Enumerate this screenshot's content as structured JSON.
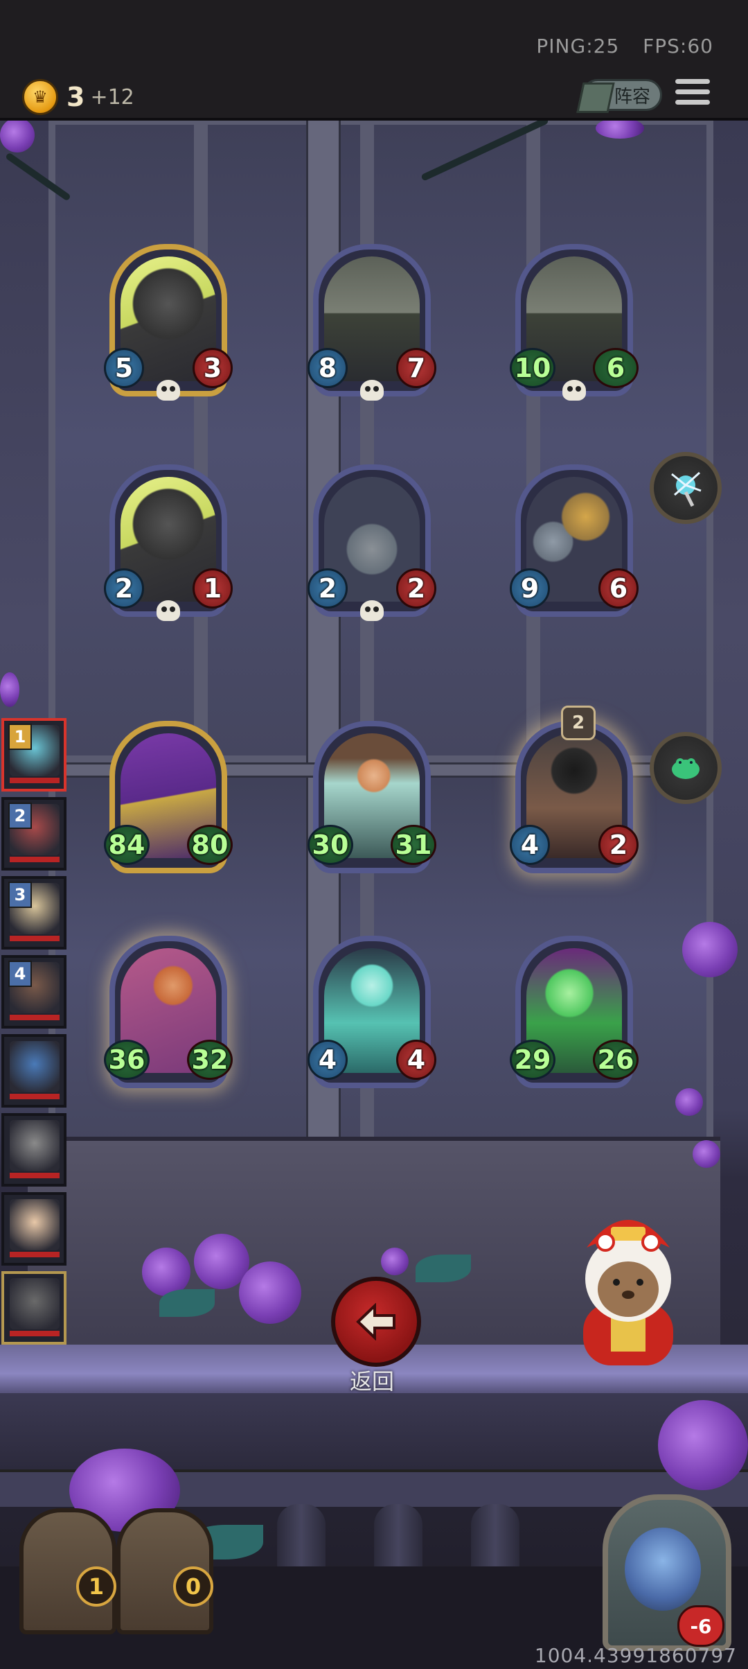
{
  "status": {
    "ping": "PING:25",
    "fps": "FPS:60"
  },
  "resources": {
    "gold": "3",
    "gold_income": "+12"
  },
  "header": {
    "lineup_label": "阵容"
  },
  "board": {
    "cards": [
      {
        "id": "r1c1",
        "art": "yellow-robot",
        "attack": "5",
        "health": "3",
        "skull": true,
        "golden": true
      },
      {
        "id": "r1c2",
        "art": "mine-cart",
        "attack": "8",
        "health": "7",
        "skull": true
      },
      {
        "id": "r1c3",
        "art": "mine-cart",
        "attack": "10",
        "health": "6",
        "skull": true
      },
      {
        "id": "r2c1",
        "art": "yellow-robot",
        "attack": "2",
        "health": "1",
        "skull": true
      },
      {
        "id": "r2c2",
        "art": "bomb-bot",
        "attack": "2",
        "health": "2",
        "skull": true
      },
      {
        "id": "r2c3",
        "art": "robot-pair",
        "attack": "9",
        "health": "6"
      },
      {
        "id": "r3c1",
        "art": "purple-mage",
        "attack": "84",
        "health": "80",
        "golden": true
      },
      {
        "id": "r3c2",
        "art": "photographer",
        "attack": "30",
        "health": "31"
      },
      {
        "id": "r3c3",
        "art": "dark-knight",
        "attack": "4",
        "health": "2",
        "tier": "2",
        "glow": true
      },
      {
        "id": "r4c1",
        "art": "archer",
        "attack": "36",
        "health": "32",
        "glow": true
      },
      {
        "id": "r4c2",
        "art": "ghost-girl",
        "attack": "4",
        "health": "4"
      },
      {
        "id": "r4c3",
        "art": "green-spirit",
        "attack": "29",
        "health": "26"
      }
    ]
  },
  "side_orbs": [
    {
      "icon": "lightning-mace-icon"
    },
    {
      "icon": "green-frog-icon"
    }
  ],
  "opponents": [
    {
      "rank": "1",
      "selected": true
    },
    {
      "rank": "2"
    },
    {
      "rank": "3"
    },
    {
      "rank": "4"
    },
    {
      "rank": ""
    },
    {
      "rank": ""
    },
    {
      "rank": ""
    },
    {
      "rank": "",
      "self": true
    }
  ],
  "back": {
    "label": "返回"
  },
  "chests": [
    {
      "count": "1"
    },
    {
      "count": "0"
    }
  ],
  "hero": {
    "health": "-6"
  },
  "build_id": "1004.43991860797"
}
